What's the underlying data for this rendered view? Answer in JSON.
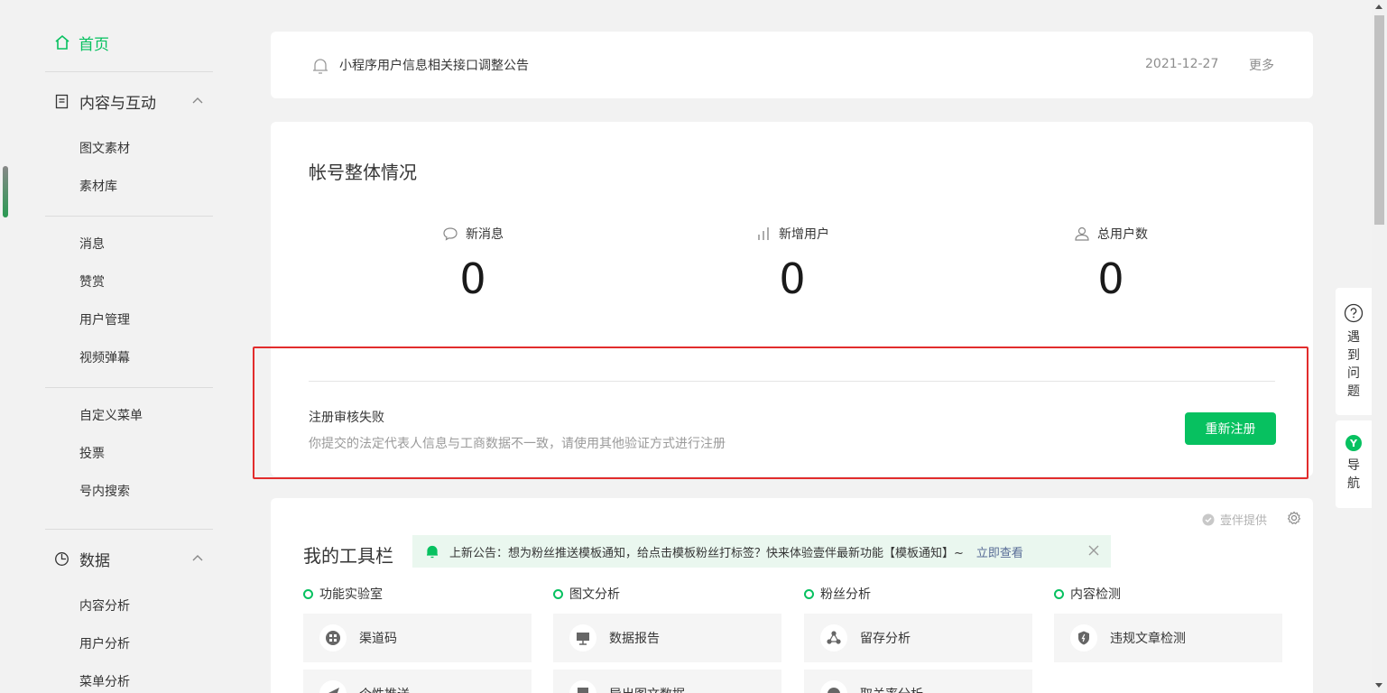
{
  "sidebar": {
    "home": "首页",
    "sections": [
      {
        "label": "内容与互动",
        "icon": "document-icon",
        "items": [
          "图文素材",
          "素材库"
        ]
      },
      {
        "label": "数据",
        "icon": "pie-chart-icon",
        "items": [
          "内容分析",
          "用户分析",
          "菜单分析"
        ]
      }
    ],
    "group2": [
      "消息",
      "赞赏",
      "用户管理",
      "视频弹幕"
    ],
    "group3": [
      "自定义菜单",
      "投票",
      "号内搜索"
    ]
  },
  "notice": {
    "title": "小程序用户信息相关接口调整公告",
    "date": "2021-12-27",
    "more": "更多"
  },
  "overview": {
    "title": "帐号整体情况",
    "stats": [
      {
        "label": "新消息",
        "value": "0",
        "icon": "message-bubble-icon"
      },
      {
        "label": "新增用户",
        "value": "0",
        "icon": "bar-chart-icon"
      },
      {
        "label": "总用户数",
        "value": "0",
        "icon": "user-icon"
      }
    ],
    "registration": {
      "title": "注册审核失败",
      "desc": "你提交的法定代表人信息与工商数据不一致，请使用其他验证方式进行注册",
      "button": "重新注册"
    }
  },
  "toolbar": {
    "title": "我的工具栏",
    "provider": "壹伴提供",
    "announcement": "上新公告：想为粉丝推送模板通知，给点击模板粉丝打标签？快来体验壹伴最新功能【模板通知】~",
    "announcement_link": "立即查看",
    "columns": [
      {
        "category": "功能实验室",
        "items": [
          "渠道码",
          "个性推送"
        ]
      },
      {
        "category": "图文分析",
        "items": [
          "数据报告",
          "导出图文数据"
        ]
      },
      {
        "category": "粉丝分析",
        "items": [
          "留存分析",
          "取关率分析"
        ]
      },
      {
        "category": "内容检测",
        "items": [
          "违规文章检测"
        ]
      }
    ]
  },
  "floating": {
    "help": "遇到问题",
    "nav": "导航"
  },
  "colors": {
    "accent": "#07c160",
    "alert_frame": "#e22c2c",
    "link": "#576b95"
  }
}
